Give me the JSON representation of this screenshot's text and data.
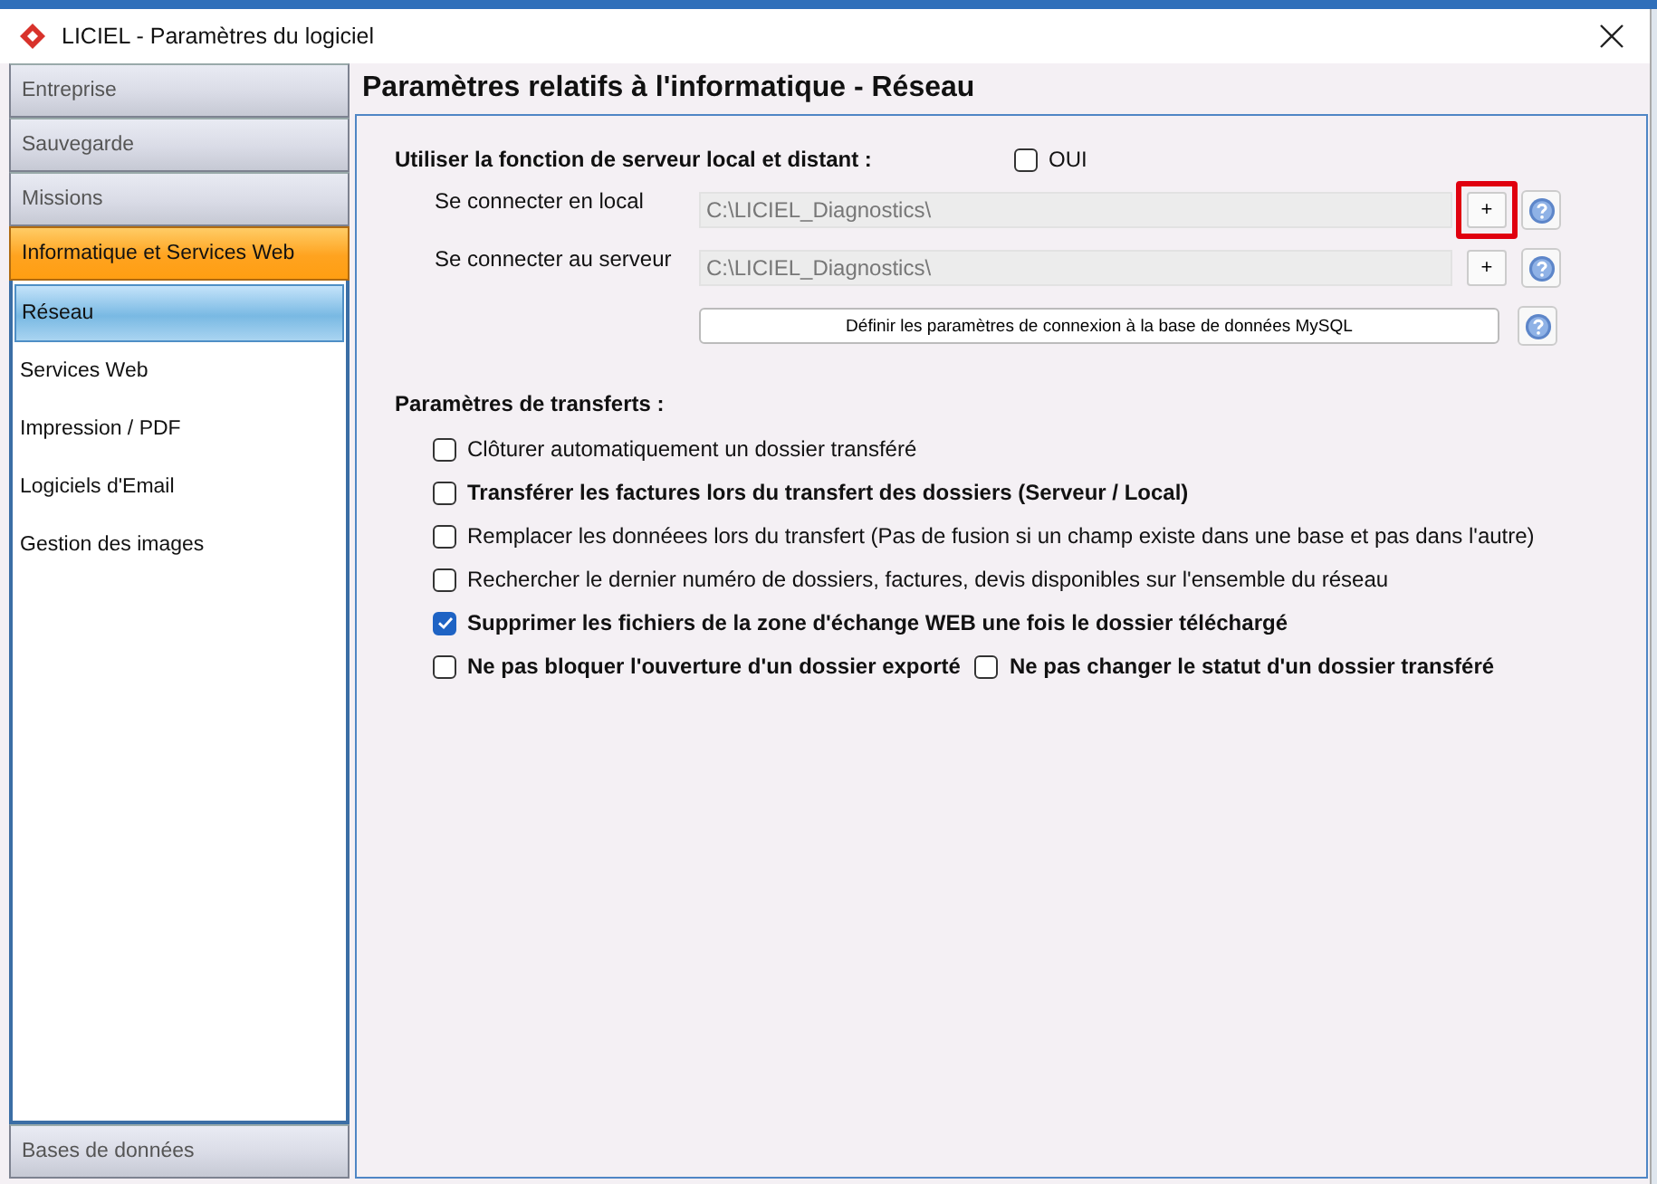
{
  "window": {
    "title": "LICIEL - Paramètres du logiciel"
  },
  "sidebar": {
    "sections": [
      {
        "label": "Entreprise",
        "selected": false
      },
      {
        "label": "Sauvegarde",
        "selected": false
      },
      {
        "label": "Missions",
        "selected": false
      },
      {
        "label": "Informatique et Services Web",
        "selected": true,
        "items": [
          {
            "label": "Réseau",
            "selected": true
          },
          {
            "label": "Services Web",
            "selected": false
          },
          {
            "label": "Impression / PDF",
            "selected": false
          },
          {
            "label": "Logiciels d'Email",
            "selected": false
          },
          {
            "label": "Gestion des images",
            "selected": false
          }
        ]
      }
    ],
    "bottom_section": {
      "label": "Bases de données",
      "selected": false
    }
  },
  "page": {
    "title": "Paramètres relatifs à l'informatique - Réseau",
    "server_function": {
      "label": "Utiliser la fonction de serveur local et distant :",
      "option": "OUI",
      "checked": false
    },
    "connections": [
      {
        "label": "Se connecter en local",
        "value": "C:\\LICIEL_Diagnostics\\",
        "browse": "+",
        "highlighted": true
      },
      {
        "label": "Se connecter au serveur",
        "value": "C:\\LICIEL_Diagnostics\\",
        "browse": "+",
        "highlighted": false
      }
    ],
    "mysql_button": "Définir les paramètres de connexion à la base de données MySQL",
    "transfers": {
      "label": "Paramètres de transferts :",
      "rows": [
        [
          {
            "label": "Clôturer automatiquement un dossier transféré",
            "bold": false,
            "checked": false
          }
        ],
        [
          {
            "label": "Transférer les factures lors du transfert des dossiers (Serveur / Local)",
            "bold": true,
            "checked": false
          }
        ],
        [
          {
            "label": "Remplacer les donnéees lors du transfert (Pas de fusion si un champ existe dans une base et pas dans l'autre)",
            "bold": false,
            "checked": false
          }
        ],
        [
          {
            "label": "Rechercher le dernier numéro de dossiers, factures, devis disponibles sur l'ensemble du réseau",
            "bold": false,
            "checked": false
          }
        ],
        [
          {
            "label": "Supprimer les fichiers de la zone d'échange WEB une fois le dossier téléchargé",
            "bold": true,
            "checked": true
          }
        ],
        [
          {
            "label": "Ne pas bloquer l'ouverture d'un dossier exporté",
            "bold": true,
            "checked": false
          },
          {
            "label": "Ne pas changer le statut d'un dossier transféré",
            "bold": true,
            "checked": false
          }
        ]
      ]
    }
  }
}
